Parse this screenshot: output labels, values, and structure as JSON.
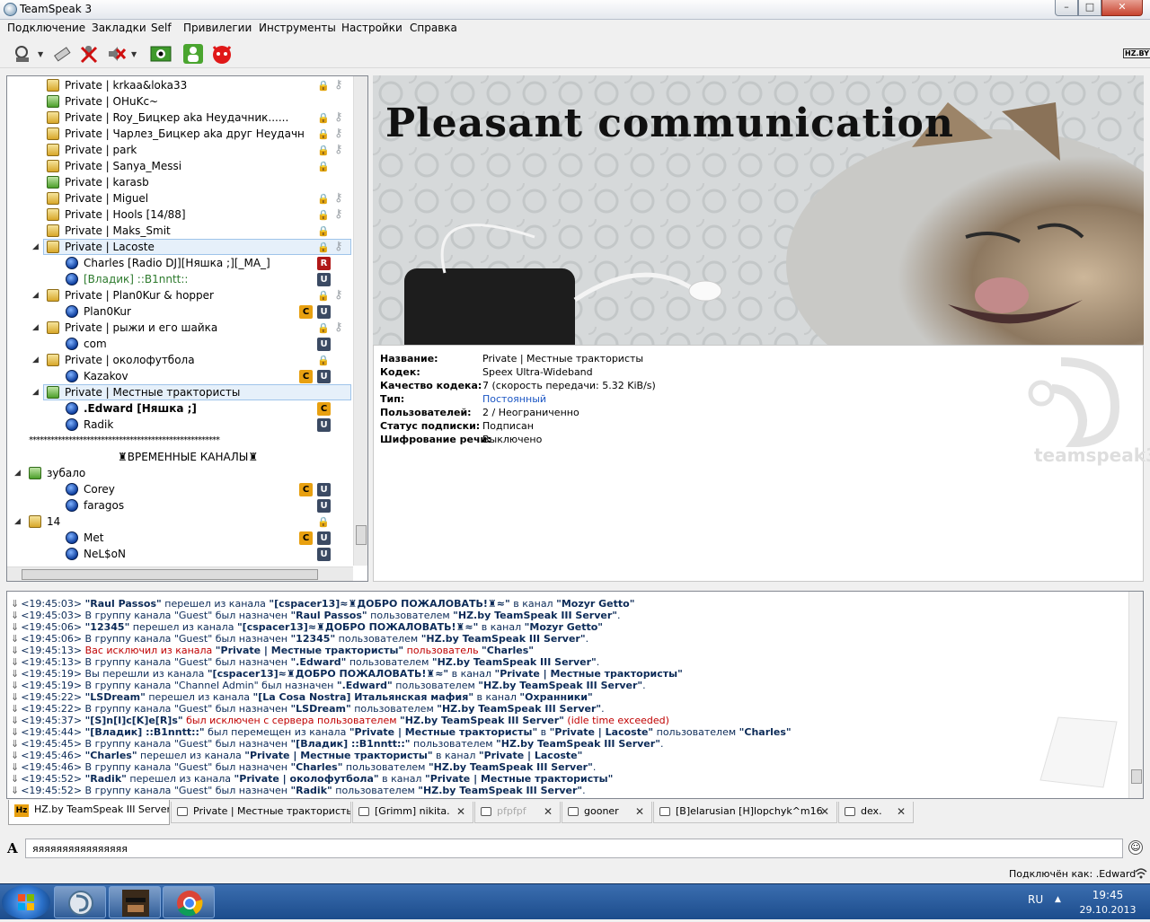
{
  "window": {
    "title": "TeamSpeak 3",
    "min_label": "–",
    "max_label": "□",
    "close_label": "✕"
  },
  "menu": [
    "Подключение",
    "Закладки",
    "Self",
    "Привилегии",
    "Инструменты",
    "Настройки",
    "Справка"
  ],
  "toolbar_right_label": "HZ.BY",
  "tree": {
    "rows": [
      {
        "label": "Private | krkaa&loka33",
        "type": "channel",
        "lock": true,
        "key": true
      },
      {
        "label": "Private | OHuKc~",
        "type": "channel",
        "lock": false,
        "key": false,
        "green": true
      },
      {
        "label": "Private | Roy_Бицкер aka Неудачник......",
        "type": "channel",
        "lock": true,
        "key": true
      },
      {
        "label": "Private | Чарлез_Бицкер aka друг Неудачн",
        "type": "channel",
        "lock": true,
        "key": true
      },
      {
        "label": "Private | park",
        "type": "channel",
        "lock": true,
        "key": true
      },
      {
        "label": "Private | Sanya_Messi",
        "type": "channel",
        "lock": true,
        "key": false
      },
      {
        "label": "Private |  karasb",
        "type": "channel",
        "lock": false,
        "key": false,
        "green": true
      },
      {
        "label": "Private | Miguel",
        "type": "channel",
        "lock": true,
        "key": true
      },
      {
        "label": "Private | Hools [14/88]",
        "type": "channel",
        "lock": true,
        "key": true
      },
      {
        "label": "Private | Maks_Smit",
        "type": "channel",
        "lock": true,
        "key": false
      },
      {
        "label": "Private | Lacoste",
        "type": "channel",
        "lock": true,
        "key": true,
        "expanded": true,
        "selected": true
      },
      {
        "label": "Charles [Radio DJ][Няшка ;][_MA_]",
        "type": "user",
        "badges": [
          "R"
        ]
      },
      {
        "label": "[Владик] ::B1nntt::",
        "type": "user",
        "badges": [
          "U"
        ],
        "greyed": true
      },
      {
        "label": "Private | Plan0Kur & hopper",
        "type": "channel",
        "lock": true,
        "key": true,
        "expanded": true
      },
      {
        "label": "Plan0Kur",
        "type": "user",
        "badges": [
          "C",
          "U"
        ]
      },
      {
        "label": "Private | рыжи и его шайка",
        "type": "channel",
        "lock": true,
        "key": true,
        "expanded": true
      },
      {
        "label": "com",
        "type": "user",
        "badges": [
          "U"
        ]
      },
      {
        "label": "Private | околофутбола",
        "type": "channel",
        "lock": true,
        "key": false,
        "expanded": true
      },
      {
        "label": "Kazakov",
        "type": "user",
        "badges": [
          "C",
          "U"
        ]
      },
      {
        "label": "Private | Местные трактористы",
        "type": "channel",
        "lock": false,
        "key": false,
        "expanded": true,
        "selected": true,
        "green": true
      },
      {
        "label": ".Edward [Няшка ;]",
        "type": "user",
        "badges": [
          "C"
        ],
        "bold": true
      },
      {
        "label": "Radik",
        "type": "user",
        "badges": [
          "U"
        ]
      },
      {
        "label": "*****************************************************",
        "type": "spacer"
      },
      {
        "label": "♜ВРЕМЕННЫЕ КАНАЛЫ♜",
        "type": "header"
      },
      {
        "label": "зубало",
        "type": "channel",
        "top": true,
        "lock": false,
        "key": false,
        "expanded": true,
        "green": true
      },
      {
        "label": "Corey",
        "type": "user",
        "badges": [
          "C",
          "U"
        ]
      },
      {
        "label": "faragos",
        "type": "user",
        "badges": [
          "U"
        ]
      },
      {
        "label": "14",
        "type": "channel",
        "top": true,
        "lock": true,
        "key": false,
        "expanded": true
      },
      {
        "label": "Met",
        "type": "user",
        "badges": [
          "C",
          "U"
        ]
      },
      {
        "label": "NeL$oN",
        "type": "user",
        "badges": [
          "U"
        ]
      }
    ]
  },
  "banner": {
    "headline": "Pleasant communication"
  },
  "channel_info": {
    "rows": [
      {
        "label": "Название:",
        "value": "Private | Местные трактористы"
      },
      {
        "label": "Кодек:",
        "value": "Speex Ultra-Wideband"
      },
      {
        "label": "Качество кодека:",
        "value": "7 (скорость передачи: 5.32 KiB/s)"
      },
      {
        "label": "Тип:",
        "value": "Постоянный",
        "link": true
      },
      {
        "label": "Пользователей:",
        "value": "2 / Неограниченно"
      },
      {
        "label": "Статус подписки:",
        "value": "Подписан"
      },
      {
        "label": "Шифрование речи:",
        "value": "Выключено"
      }
    ],
    "watermark": "teamspeak3"
  },
  "log": [
    {
      "parts": [
        [
          "t",
          "<19:45:03> "
        ],
        [
          "b",
          "\"Raul Passos\""
        ],
        [
          "t",
          " перешел из канала "
        ],
        [
          "b",
          "\"[cspacer13]≈♜ДОБРО ПОЖАЛОВАТЬ!♜≈\""
        ],
        [
          "t",
          " в канал "
        ],
        [
          "b",
          "\"Mozyr Getto\""
        ]
      ]
    },
    {
      "parts": [
        [
          "t",
          "<19:45:03> В группу канала \"Guest\" был назначен "
        ],
        [
          "b",
          "\"Raul Passos\""
        ],
        [
          "t",
          " пользователем "
        ],
        [
          "b",
          "\"HZ.by TeamSpeak III Server\""
        ],
        [
          "t",
          "."
        ]
      ]
    },
    {
      "parts": [
        [
          "t",
          "<19:45:06> "
        ],
        [
          "b",
          "\"12345\""
        ],
        [
          "t",
          " перешел из канала "
        ],
        [
          "b",
          "\"[cspacer13]≈♜ДОБРО ПОЖАЛОВАТЬ!♜≈\""
        ],
        [
          "t",
          " в канал "
        ],
        [
          "b",
          "\"Mozyr Getto\""
        ]
      ]
    },
    {
      "parts": [
        [
          "t",
          "<19:45:06> В группу канала \"Guest\" был назначен "
        ],
        [
          "b",
          "\"12345\""
        ],
        [
          "t",
          " пользователем "
        ],
        [
          "b",
          "\"HZ.by TeamSpeak III Server\""
        ],
        [
          "t",
          "."
        ]
      ]
    },
    {
      "parts": [
        [
          "t",
          "<19:45:13> "
        ],
        [
          "r",
          "Вас исключил из канала "
        ],
        [
          "b",
          "\"Private | Местные трактористы\""
        ],
        [
          "r",
          " пользователь "
        ],
        [
          "b",
          "\"Charles\""
        ]
      ]
    },
    {
      "parts": [
        [
          "t",
          "<19:45:13> В группу канала \"Guest\" был назначен "
        ],
        [
          "b",
          "\".Edward\""
        ],
        [
          "t",
          " пользователем "
        ],
        [
          "b",
          "\"HZ.by TeamSpeak III Server\""
        ],
        [
          "t",
          "."
        ]
      ]
    },
    {
      "parts": [
        [
          "t",
          "<19:45:19> Вы перешли из канала "
        ],
        [
          "b",
          "\"[cspacer13]≈♜ДОБРО ПОЖАЛОВАТЬ!♜≈\""
        ],
        [
          "t",
          " в канал "
        ],
        [
          "b",
          "\"Private | Местные трактористы\""
        ]
      ]
    },
    {
      "parts": [
        [
          "t",
          "<19:45:19> В группу канала \"Channel Admin\" был назначен "
        ],
        [
          "b",
          "\".Edward\""
        ],
        [
          "t",
          " пользователем "
        ],
        [
          "b",
          "\"HZ.by TeamSpeak III Server\""
        ],
        [
          "t",
          "."
        ]
      ]
    },
    {
      "parts": [
        [
          "t",
          "<19:45:22> "
        ],
        [
          "b",
          "\"LSDream\""
        ],
        [
          "t",
          " перешел из канала "
        ],
        [
          "b",
          "\"[La Cosa Nostra] Итальянская мафия\""
        ],
        [
          "t",
          " в канал "
        ],
        [
          "b",
          "\"Охранники\""
        ]
      ]
    },
    {
      "parts": [
        [
          "t",
          "<19:45:22> В группу канала \"Guest\" был назначен "
        ],
        [
          "b",
          "\"LSDream\""
        ],
        [
          "t",
          " пользователем "
        ],
        [
          "b",
          "\"HZ.by TeamSpeak III Server\""
        ],
        [
          "t",
          "."
        ]
      ]
    },
    {
      "parts": [
        [
          "t",
          "<19:45:37> "
        ],
        [
          "b",
          "\"[S]n[I]c[K]e[R]s\""
        ],
        [
          "r",
          " был исключен с сервера пользователем "
        ],
        [
          "b",
          "\"HZ.by TeamSpeak III Server\""
        ],
        [
          "r",
          " (idle time exceeded)"
        ]
      ]
    },
    {
      "parts": [
        [
          "t",
          "<19:45:44> "
        ],
        [
          "b",
          "\"[Владик] ::B1nntt::\""
        ],
        [
          "t",
          " был перемещен из канала "
        ],
        [
          "b",
          "\"Private | Местные трактористы\""
        ],
        [
          "t",
          " в "
        ],
        [
          "b",
          "\"Private | Lacoste\""
        ],
        [
          "t",
          " пользователем "
        ],
        [
          "b",
          "\"Charles\""
        ]
      ]
    },
    {
      "parts": [
        [
          "t",
          "<19:45:45> В группу канала \"Guest\" был назначен "
        ],
        [
          "b",
          "\"[Владик] ::B1nntt::\""
        ],
        [
          "t",
          " пользователем "
        ],
        [
          "b",
          "\"HZ.by TeamSpeak III Server\""
        ],
        [
          "t",
          "."
        ]
      ]
    },
    {
      "parts": [
        [
          "t",
          "<19:45:46> "
        ],
        [
          "b",
          "\"Charles\""
        ],
        [
          "t",
          " перешел из канала "
        ],
        [
          "b",
          "\"Private | Местные трактористы\""
        ],
        [
          "t",
          " в канал "
        ],
        [
          "b",
          "\"Private | Lacoste\""
        ]
      ]
    },
    {
      "parts": [
        [
          "t",
          "<19:45:46> В группу канала \"Guest\" был назначен "
        ],
        [
          "b",
          "\"Charles\""
        ],
        [
          "t",
          " пользователем "
        ],
        [
          "b",
          "\"HZ.by TeamSpeak III Server\""
        ],
        [
          "t",
          "."
        ]
      ]
    },
    {
      "parts": [
        [
          "t",
          "<19:45:52> "
        ],
        [
          "b",
          "\"Radik\""
        ],
        [
          "t",
          " перешел из канала "
        ],
        [
          "b",
          "\"Private | околофутбола\""
        ],
        [
          "t",
          " в канал "
        ],
        [
          "b",
          "\"Private | Местные трактористы\""
        ]
      ]
    },
    {
      "parts": [
        [
          "t",
          "<19:45:52> В группу канала \"Guest\" был назначен "
        ],
        [
          "b",
          "\"Radik\""
        ],
        [
          "t",
          " пользователем "
        ],
        [
          "b",
          "\"HZ.by TeamSpeak III Server\""
        ],
        [
          "t",
          "."
        ]
      ]
    }
  ],
  "tabs": [
    {
      "label": "HZ.by TeamSpeak III Server",
      "active": true,
      "closable": false,
      "hz": true
    },
    {
      "label": "Private | Местные трактористы",
      "closable": false
    },
    {
      "label": "[Grimm] nikita.",
      "closable": true
    },
    {
      "label": "pfpfpf",
      "closable": true,
      "faded": true
    },
    {
      "label": "gooner",
      "closable": true
    },
    {
      "label": "[B]elarusian [H]lopchyk^m16",
      "closable": true
    },
    {
      "label": "dex.",
      "closable": true
    }
  ],
  "chat": {
    "value": "яяяяяяяяяяяяяяяя"
  },
  "status": {
    "connected_as": "Подключён как: .Edward"
  },
  "taskbar": {
    "lang": "RU",
    "time": "19:45",
    "date": "29.10.2013"
  }
}
